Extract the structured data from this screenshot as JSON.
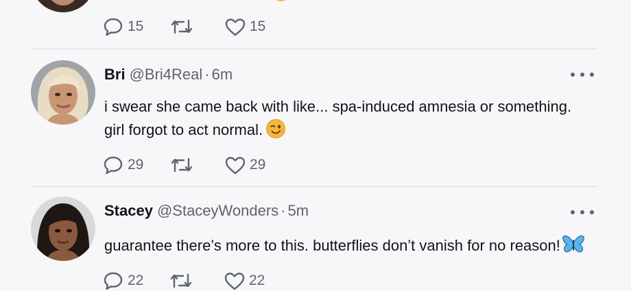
{
  "top_tweet": {
    "replies": "15",
    "likes": "15"
  },
  "tweets": [
    {
      "name": "Bri",
      "handle": "@Bri4Real",
      "separator": "·",
      "time": "6m",
      "text_line1": "i swear she came back with like... spa-induced amnesia or something.",
      "text_line2": "girl forgot to act normal.",
      "emoji": "wink-smile-emoji",
      "replies": "29",
      "likes": "29"
    },
    {
      "name": "Stacey",
      "handle": "@StaceyWonders",
      "separator": "·",
      "time": "5m",
      "text_line1": "guarantee there’s more to this. butterflies don’t vanish for no reason!",
      "emoji": "butterfly-emoji",
      "replies": "22",
      "likes": "22"
    }
  ],
  "icons": {
    "reply": "reply-icon",
    "retweet": "retweet-icon",
    "like": "heart-icon",
    "more": "more-options-icon"
  },
  "colors": {
    "background": "#f7f7f9",
    "text": "#0f1419",
    "secondary": "#5b6470",
    "divider": "#d7dbe0"
  }
}
